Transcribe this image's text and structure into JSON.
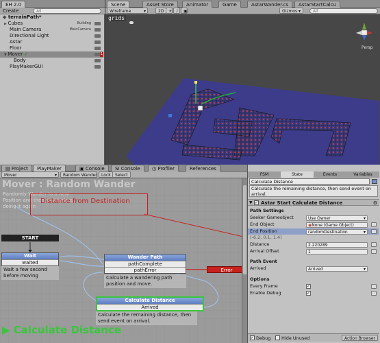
{
  "hierarchy": {
    "tab": "EH 2.0",
    "create": "Create",
    "search_placeholder": "All",
    "root": "terrainPath*",
    "items": [
      {
        "name": "Cubes",
        "tag": "Building"
      },
      {
        "name": "Main Camera",
        "tag": "MainCamera"
      },
      {
        "name": "Directional Light",
        "tag": ""
      },
      {
        "name": "Astar",
        "tag": ""
      },
      {
        "name": "Floor",
        "tag": ""
      },
      {
        "name": "Mover",
        "tag": ""
      },
      {
        "name": "Body",
        "tag": ""
      },
      {
        "name": "PlayMakerGUI",
        "tag": ""
      }
    ],
    "mover_count": "1"
  },
  "scene": {
    "tabs": [
      "Scene",
      "Asset Store",
      "Animator",
      "Game",
      "AstarWander.cs",
      "AstarStartCalcu"
    ],
    "shading": "Wireframe",
    "mode_2d": "2D",
    "gizmos": "Gizmos",
    "search_placeholder": "All",
    "label": "grids",
    "persp": "Persp"
  },
  "bottom_tabs": [
    "Project",
    "PlayMaker",
    "Console",
    "SI Console",
    "Profiler",
    "References"
  ],
  "fsm_toolbar": {
    "object": "Mover",
    "fsm": "Random Wander",
    "lock": "Lock",
    "select": "Select"
  },
  "graph": {
    "title": "Mover : Random Wander",
    "description": "Randomly Wander to a new Position and then wait before doing it again",
    "comment": "Distance from Destination",
    "start_label": "START",
    "wait": {
      "title": "Wait",
      "event": "waited",
      "note": "Wait a few second before moving"
    },
    "wander": {
      "title": "Wander Path",
      "events": [
        "pathComplete",
        "pathError"
      ],
      "note": "Calculate a wandering path position and move."
    },
    "error": "Error",
    "calc": {
      "title": "Calculate Distance",
      "event": "Arrived",
      "note": "Calculate the remaining distance, then send event on arrival."
    },
    "current_state": "Calculate Distance"
  },
  "inspector": {
    "tabs": [
      "FSM",
      "State",
      "Events",
      "Variables"
    ],
    "state_name": "Calculate Distance",
    "state_desc": "Calculate the remaining distance, then send event on arrival.",
    "action_title": "Astar Start Calculate Distance",
    "path_settings": "Path Settings",
    "seeker_label": "Seeker Gameobject",
    "seeker_value": "Use Owner",
    "end_object_label": "End Object",
    "end_object_value": "None (Game Object)",
    "end_position_label": "End Position",
    "end_position_value": "randomDestination",
    "end_position_vector": "(-6.2, 0.1, 1.4)",
    "distance_label": "Distance",
    "distance_value": "2.220289",
    "arrival_label": "Arrival Offset",
    "arrival_value": "1",
    "path_event": "Path Event",
    "arrived_label": "Arrived",
    "arrived_value": "Arrived",
    "options": "Options",
    "every_frame": "Every Frame",
    "enable_debug": "Enable Debug",
    "debug": "Debug",
    "hide_unused": "Hide Unused",
    "action_browser": "Action Browser"
  },
  "colors": {
    "accent_green": "#39c63c",
    "error_red": "#c7221d",
    "node_blue": "#6f8fcf",
    "comment_red": "#d42020",
    "selection_blue": "#3e5d9a"
  }
}
